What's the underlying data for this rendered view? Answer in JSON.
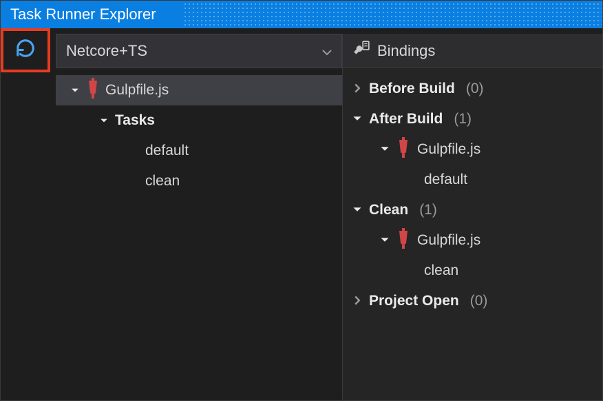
{
  "title": "Task Runner Explorer",
  "project_dropdown": {
    "selected": "Netcore+TS"
  },
  "tree": {
    "root": {
      "label": "Gulpfile.js",
      "tasks_label": "Tasks",
      "tasks": [
        {
          "label": "default"
        },
        {
          "label": "clean"
        }
      ]
    }
  },
  "bindings": {
    "header": "Bindings",
    "groups": [
      {
        "label": "Before Build",
        "count": "(0)",
        "expanded": false,
        "items": []
      },
      {
        "label": "After Build",
        "count": "(1)",
        "expanded": true,
        "items": [
          {
            "file": "Gulpfile.js",
            "task": "default"
          }
        ]
      },
      {
        "label": "Clean",
        "count": "(1)",
        "expanded": true,
        "items": [
          {
            "file": "Gulpfile.js",
            "task": "clean"
          }
        ]
      },
      {
        "label": "Project Open",
        "count": "(0)",
        "expanded": false,
        "items": []
      }
    ]
  }
}
